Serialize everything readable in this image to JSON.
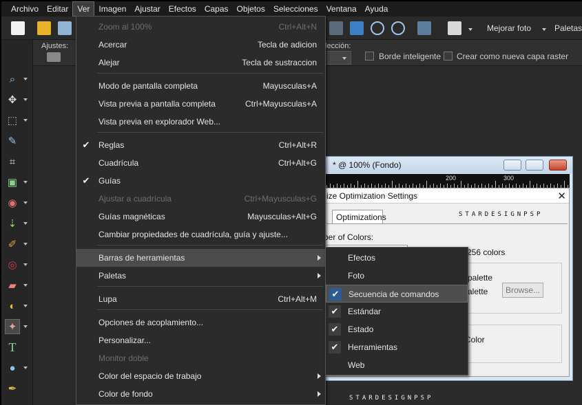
{
  "menubar": {
    "items": [
      "Archivo",
      "Editar",
      "Ver",
      "Imagen",
      "Ajustar",
      "Efectos",
      "Capas",
      "Objetos",
      "Selecciones",
      "Ventana",
      "Ayuda"
    ]
  },
  "toolbar": {
    "enhance_photo": "Mejorar foto",
    "palettes": "Paletas"
  },
  "options": {
    "presets_label": "Ajustes:",
    "selection_label": "elección:",
    "smart_edge": "Borde inteligente",
    "new_raster": "Crear como nueva capa raster"
  },
  "document": {
    "title": "* @ 100% (Fondo)",
    "ruler_marks": [
      "200",
      "300"
    ]
  },
  "dialog": {
    "title": "ize Optimization Settings",
    "tab": "Optimizations",
    "number_colors": "ber of Colors:",
    "colors_256": "256 colors",
    "palette1": "palette",
    "palette2": "alette",
    "browse": "Browse...",
    "color": "Color",
    "watermark": "STARDESIGNPSP"
  },
  "ver_menu": {
    "items": [
      {
        "label": "Zoom al 100%",
        "shortcut": "Ctrl+Alt+N",
        "disabled": true
      },
      {
        "label": "Acercar",
        "shortcut": "Tecla de adicion"
      },
      {
        "label": "Alejar",
        "shortcut": "Tecla de sustraccion"
      },
      {
        "label": "Modo de pantalla completa",
        "shortcut": "Mayusculas+A"
      },
      {
        "label": "Vista previa a pantalla completa",
        "shortcut": "Ctrl+Mayusculas+A"
      },
      {
        "label": "Vista previa en explorador Web...",
        "shortcut": ""
      },
      {
        "label": "Reglas",
        "shortcut": "Ctrl+Alt+R",
        "checked": true
      },
      {
        "label": "Cuadrícula",
        "shortcut": "Ctrl+Alt+G"
      },
      {
        "label": "Guías",
        "shortcut": "",
        "checked": true
      },
      {
        "label": "Ajustar a cuadrícula",
        "shortcut": "Ctrl+Mayusculas+G",
        "disabled": true
      },
      {
        "label": "Guías magnéticas",
        "shortcut": "Mayusculas+Alt+G"
      },
      {
        "label": "Cambiar propiedades de cuadrícula, guía y ajuste...",
        "shortcut": ""
      },
      {
        "label": "Barras de herramientas",
        "shortcut": "",
        "submenu": true
      },
      {
        "label": "Paletas",
        "shortcut": "",
        "submenu": true
      },
      {
        "label": "Lupa",
        "shortcut": "Ctrl+Alt+M"
      },
      {
        "label": "Opciones de acoplamiento...",
        "shortcut": ""
      },
      {
        "label": "Personalizar...",
        "shortcut": ""
      },
      {
        "label": "Monitor doble",
        "shortcut": "",
        "disabled": true
      },
      {
        "label": "Color del espacio de trabajo",
        "shortcut": "",
        "submenu": true
      },
      {
        "label": "Color de fondo",
        "shortcut": "",
        "submenu": true
      }
    ]
  },
  "toolbars_submenu": {
    "items": [
      {
        "label": "Efectos",
        "checked": false
      },
      {
        "label": "Foto",
        "checked": false
      },
      {
        "label": "Secuencia de comandos",
        "checked": true
      },
      {
        "label": "Estándar",
        "checked": true
      },
      {
        "label": "Estado",
        "checked": true
      },
      {
        "label": "Herramientas",
        "checked": true
      },
      {
        "label": "Web",
        "checked": false
      }
    ]
  },
  "footer_watermark": "STARDESIGNPSP",
  "colors": {
    "menu_bg": "#2b2b2b",
    "highlight": "#4b4b4b",
    "check_active": "#2c5c93"
  }
}
